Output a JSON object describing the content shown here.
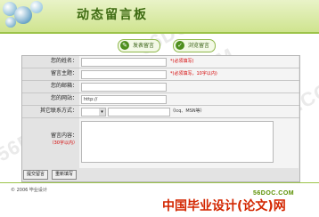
{
  "header": {
    "title": "动态留言板"
  },
  "actions": {
    "post_label": "发表留言",
    "view_label": "浏览留言"
  },
  "form": {
    "fields": [
      {
        "label": "您的姓名：",
        "value": "",
        "required": "*(必须填写)"
      },
      {
        "label": "留言主题：",
        "value": "",
        "required": "*(必须填写，10字以内)"
      },
      {
        "label": "您的邮箱：",
        "value": ""
      },
      {
        "label": "您的网站：",
        "value": "http://"
      }
    ],
    "contact": {
      "label": "其它联系方式：",
      "hint": "（Icq、MSN等）"
    },
    "message": {
      "label": "留言内容：",
      "note": "（30字以内）"
    },
    "submit_label": "提交留言",
    "reset_label": "重新填写"
  },
  "footer": {
    "copyright": "© 2006 毕业设计"
  },
  "watermarks": [
    "56DOC.COM",
    "56DOC.COM",
    "56DOC.COM",
    "56DOC.COM",
    "56DOC.COM"
  ],
  "logo": {
    "site": "56DOC.COM",
    "text_cn": "中国",
    "text_main": "毕业设计(论文)网"
  },
  "colors": {
    "accent_green": "#9cc34a",
    "required_red": "#d40000",
    "logo_red": "#d32600"
  }
}
